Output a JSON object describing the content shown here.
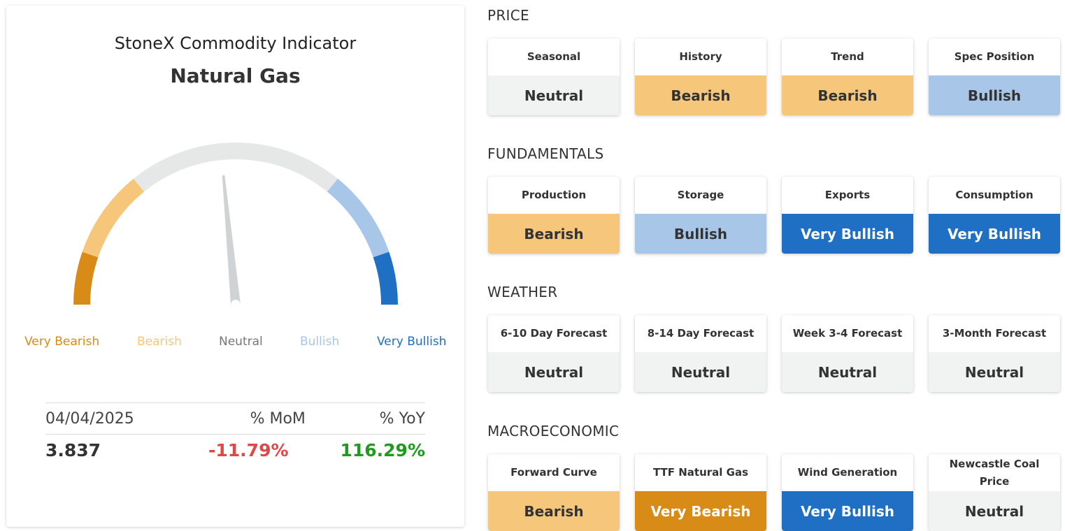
{
  "colors": {
    "very_bearish": "#d98b17",
    "bearish": "#f6c67a",
    "neutral": "#f1f2f2",
    "bullish": "#a8c6e8",
    "very_bullish": "#1f6fc5",
    "negative_text": "#e04848",
    "positive_text": "#1f9a1f"
  },
  "indicator": {
    "title": "StoneX Commodity Indicator",
    "commodity": "Natural Gas",
    "gauge": {
      "level": 0.47,
      "labels": [
        "Very Bearish",
        "Bearish",
        "Neutral",
        "Bullish",
        "Very Bullish"
      ]
    },
    "stats": {
      "headers": [
        "04/04/2025",
        "% MoM",
        "% YoY"
      ],
      "values": [
        "3.837",
        "-11.79%",
        "116.29%"
      ]
    }
  },
  "sections": [
    {
      "title": "PRICE",
      "tiles": [
        {
          "label": "Seasonal",
          "value": "Neutral",
          "rating": "neutral"
        },
        {
          "label": "History",
          "value": "Bearish",
          "rating": "bearish"
        },
        {
          "label": "Trend",
          "value": "Bearish",
          "rating": "bearish"
        },
        {
          "label": "Spec Position",
          "value": "Bullish",
          "rating": "bullish"
        }
      ]
    },
    {
      "title": "FUNDAMENTALS",
      "tiles": [
        {
          "label": "Production",
          "value": "Bearish",
          "rating": "bearish"
        },
        {
          "label": "Storage",
          "value": "Bullish",
          "rating": "bullish"
        },
        {
          "label": "Exports",
          "value": "Very Bullish",
          "rating": "very_bullish"
        },
        {
          "label": "Consumption",
          "value": "Very Bullish",
          "rating": "very_bullish"
        }
      ]
    },
    {
      "title": "WEATHER",
      "tiles": [
        {
          "label": "6-10 Day Forecast",
          "value": "Neutral",
          "rating": "neutral"
        },
        {
          "label": "8-14 Day Forecast",
          "value": "Neutral",
          "rating": "neutral"
        },
        {
          "label": "Week 3-4 Forecast",
          "value": "Neutral",
          "rating": "neutral"
        },
        {
          "label": "3-Month Forecast",
          "value": "Neutral",
          "rating": "neutral"
        }
      ]
    },
    {
      "title": "MACROECONOMIC",
      "tiles": [
        {
          "label": "Forward Curve",
          "value": "Bearish",
          "rating": "bearish"
        },
        {
          "label": "TTF Natural Gas",
          "value": "Very Bearish",
          "rating": "very_bearish"
        },
        {
          "label": "Wind Generation",
          "value": "Very Bullish",
          "rating": "very_bullish"
        },
        {
          "label": "Newcastle Coal Price",
          "value": "Neutral",
          "rating": "neutral"
        }
      ]
    }
  ]
}
